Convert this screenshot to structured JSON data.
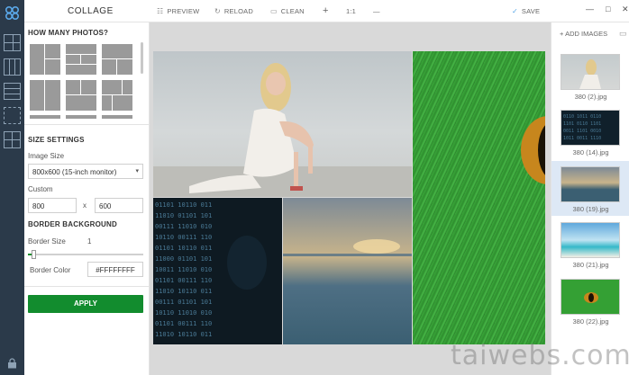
{
  "app": {
    "title": "COLLAGE"
  },
  "toolbar": {
    "preview": "PREVIEW",
    "reload": "RELOAD",
    "clean": "CLEAN",
    "plus": "+",
    "ratio": "1:1",
    "minus": "—",
    "save": "SAVE"
  },
  "window": {
    "minimize": "—",
    "maximize": "□",
    "close": "✕"
  },
  "panel": {
    "how_many": "HOW MANY PHOTOS?",
    "size_settings": "SIZE SETTINGS",
    "image_size_label": "Image Size",
    "image_size_value": "800x600 (15-inch monitor)",
    "custom_label": "Custom",
    "width": "800",
    "x": "x",
    "height": "600",
    "border_bg": "BORDER BACKGROUND",
    "border_size_label": "Border Size",
    "border_size_value": "1",
    "border_color_label": "Border Color",
    "border_color_value": "#FFFFFFFF",
    "apply": "APPLY"
  },
  "images": {
    "add_label": "ADD IMAGES",
    "items": [
      {
        "name": "380 (2).jpg"
      },
      {
        "name": "380 (14).jpg"
      },
      {
        "name": "380 (19).jpg"
      },
      {
        "name": "380 (21).jpg"
      },
      {
        "name": "380 (22).jpg"
      }
    ]
  },
  "watermark": "taiwebs.com",
  "colors": {
    "accent": "#128c2e",
    "rail": "#2b3a4a",
    "selected": "#dde8f5"
  }
}
